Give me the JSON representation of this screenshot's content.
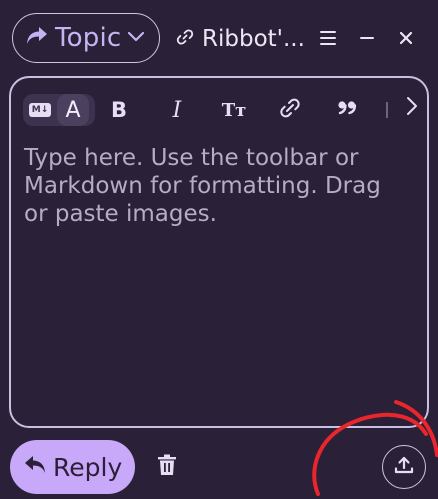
{
  "header": {
    "topic_label": "Topic",
    "title": "Ribbot'..."
  },
  "editor": {
    "placeholder": "Type here. Use the toolbar or Markdown for formatting. Drag or paste images.",
    "mode_badge": "M↓",
    "mode_rich": "A",
    "toolbar": {
      "bold": "B",
      "italic": "I",
      "heading": "Tт",
      "link": "link-icon",
      "quote": "❞",
      "more": "chevron-right-icon"
    }
  },
  "footer": {
    "reply_label": "Reply"
  },
  "colors": {
    "background": "#2a2138",
    "accent": "#c8a8f8",
    "annotation": "#e8262c"
  }
}
